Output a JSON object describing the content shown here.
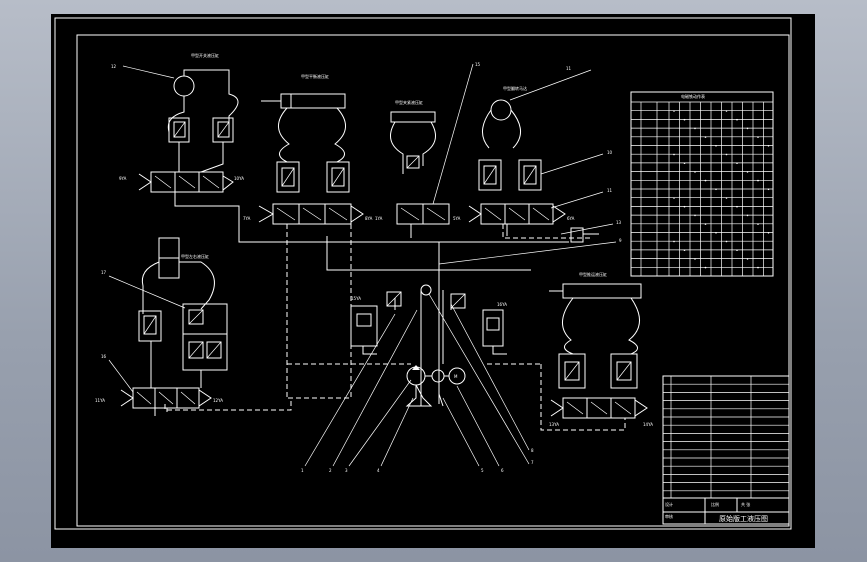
{
  "drawing": {
    "background": "#000000",
    "line_color": "#ffffff",
    "title_block": {
      "title": "原始版工液压图",
      "scale": "比例",
      "sheet": "共 张",
      "designer": "设计",
      "checker": "审核"
    },
    "callouts": [
      "1",
      "2",
      "3",
      "4",
      "5",
      "6",
      "7",
      "8",
      "9",
      "10",
      "11",
      "12",
      "13",
      "14",
      "15",
      "16",
      "17",
      "18"
    ],
    "port_labels": {
      "v1_left": "3YA",
      "v1_right": "4YA",
      "v2_left": "5YA",
      "v2_right": "6YA",
      "v3_left": "1YA",
      "v4_left": "7YA",
      "v4_right": "8YA",
      "v5_left": "9YA",
      "v5_right": "10YA",
      "v6_left": "11YA",
      "v6_right": "12YA",
      "v7_left": "13YA",
      "v7_right": "14YA",
      "solenoid_left": "15YA",
      "solenoid_right": "16YA"
    },
    "table_header": "电磁铁动作表"
  }
}
